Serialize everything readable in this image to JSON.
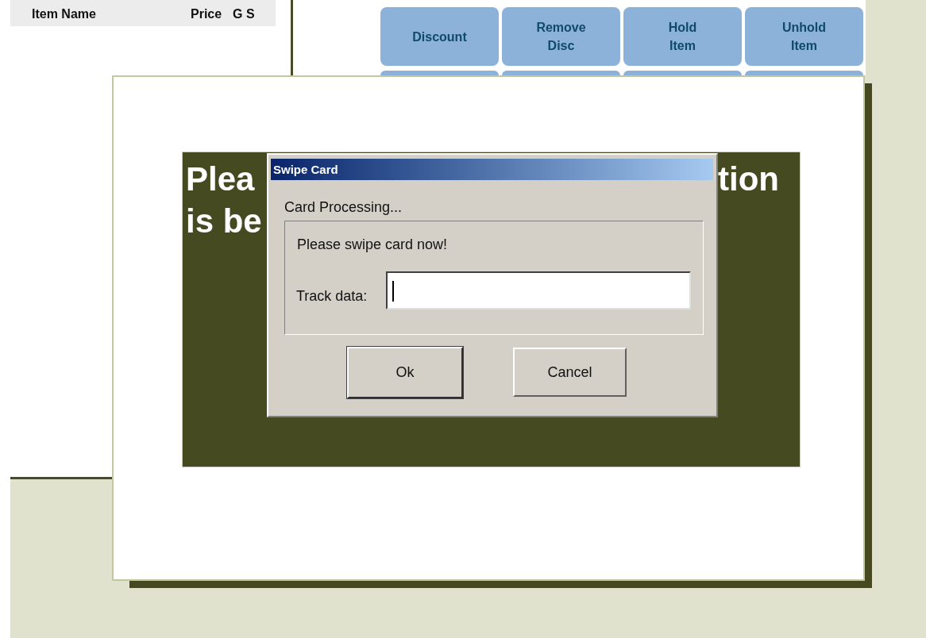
{
  "order_list": {
    "columns": [
      "Item Name",
      "Price",
      "G S"
    ]
  },
  "function_buttons": [
    "Discount",
    "Remove\nDisc",
    "Hold\nItem",
    "Unhold\nItem"
  ],
  "message_panel": {
    "fragments": [
      "Plea",
      "tion",
      "is be"
    ]
  },
  "dialog": {
    "title": "Swipe Card",
    "status": "Card Processing...",
    "prompt": "Please swipe card now!",
    "field_label": "Track data:",
    "buttons": [
      {
        "label": "Ok",
        "default": true
      },
      {
        "label": "Cancel",
        "default": false
      }
    ]
  }
}
